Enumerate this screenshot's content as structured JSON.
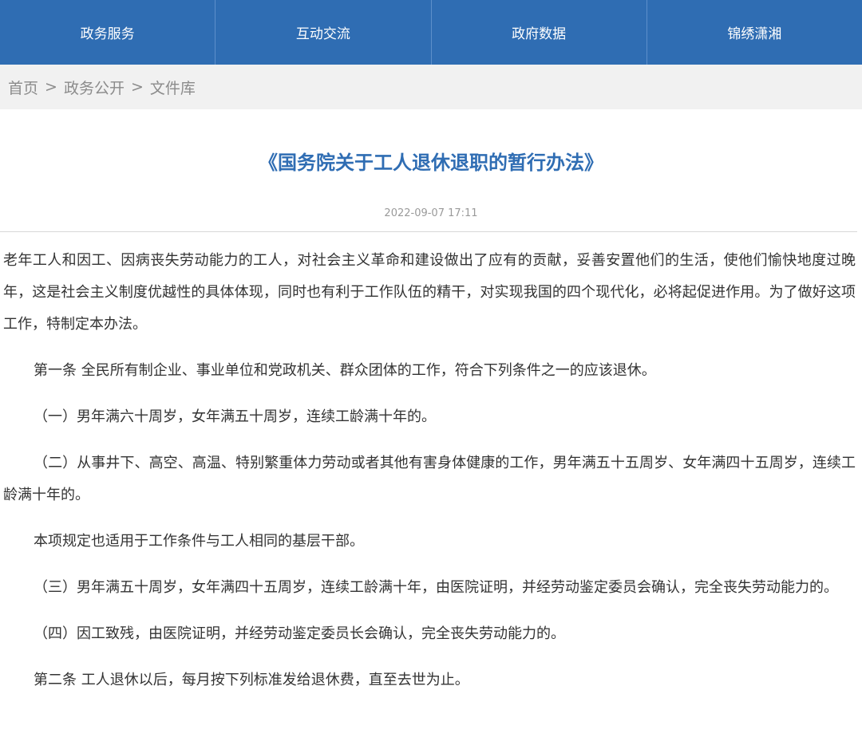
{
  "nav": {
    "items": [
      {
        "label": "政务服务"
      },
      {
        "label": "互动交流"
      },
      {
        "label": "政府数据"
      },
      {
        "label": "锦绣潇湘"
      }
    ]
  },
  "breadcrumb": {
    "home": "首页",
    "sep": ">",
    "section": "政务公开",
    "current": "文件库"
  },
  "article": {
    "title": "《国务院关于工人退休退职的暂行办法》",
    "date": "2022-09-07 17:11",
    "paragraphs": [
      "老年工人和因工、因病丧失劳动能力的工人，对社会主义革命和建设做出了应有的贡献，妥善安置他们的生活，使他们愉快地度过晚年，这是社会主义制度优越性的具体体现，同时也有利于工作队伍的精干，对实现我国的四个现代化，必将起促进作用。为了做好这项工作，特制定本办法。",
      "第一条 全民所有制企业、事业单位和党政机关、群众团体的工作，符合下列条件之一的应该退休。",
      "（一）男年满六十周岁，女年满五十周岁，连续工龄满十年的。",
      "（二）从事井下、高空、高温、特别繁重体力劳动或者其他有害身体健康的工作，男年满五十五周岁、女年满四十五周岁，连续工龄满十年的。",
      "本项规定也适用于工作条件与工人相同的基层干部。",
      "（三）男年满五十周岁，女年满四十五周岁，连续工龄满十年，由医院证明，并经劳动鉴定委员会确认，完全丧失劳动能力的。",
      "（四）因工致残，由医院证明，并经劳动鉴定委员长会确认，完全丧失劳动能力的。",
      "第二条 工人退休以后，每月按下列标准发给退休费，直至去世为止。"
    ]
  },
  "colors": {
    "nav_bg": "#2f6db3",
    "title": "#2f6db3",
    "breadcrumb_bg": "#f1f1f1"
  }
}
